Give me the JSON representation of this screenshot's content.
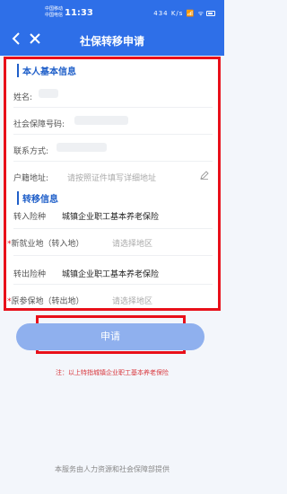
{
  "status_bar": {
    "carrier_line1": "中国移动",
    "carrier_line2": "中国电信",
    "time": "11:33",
    "indicator_text": "434 K/s",
    "signal_text": "📶 ᯤ"
  },
  "header": {
    "title": "社保转移申请"
  },
  "basic_info": {
    "section_title": "本人基本信息",
    "name_label": "姓名:",
    "ssn_label": "社会保障号码:",
    "contact_label": "联系方式:",
    "household_label": "户籍地址:",
    "household_placeholder": "请按照证件填写详细地址"
  },
  "transfer_info": {
    "section_title": "转移信息",
    "transfer_in_type_label": "转入险种",
    "transfer_in_type_value": "城镇企业职工基本养老保险",
    "new_location_label": "新就业地（转入地）",
    "new_location_placeholder": "请选择地区",
    "transfer_out_type_label": "转出险种",
    "transfer_out_type_value": "城镇企业职工基本养老保险",
    "original_location_label": "原参保地（转出地）",
    "original_location_placeholder": "请选择地区",
    "required_mark": "*"
  },
  "apply_button": "申请",
  "note": "注：以上特指城镇企业职工基本养老保险",
  "footer": "本服务由人力资源和社会保障部提供",
  "colors": {
    "primary": "#2e6fe8",
    "button": "#8fb0ee",
    "highlight": "#e8101a"
  }
}
